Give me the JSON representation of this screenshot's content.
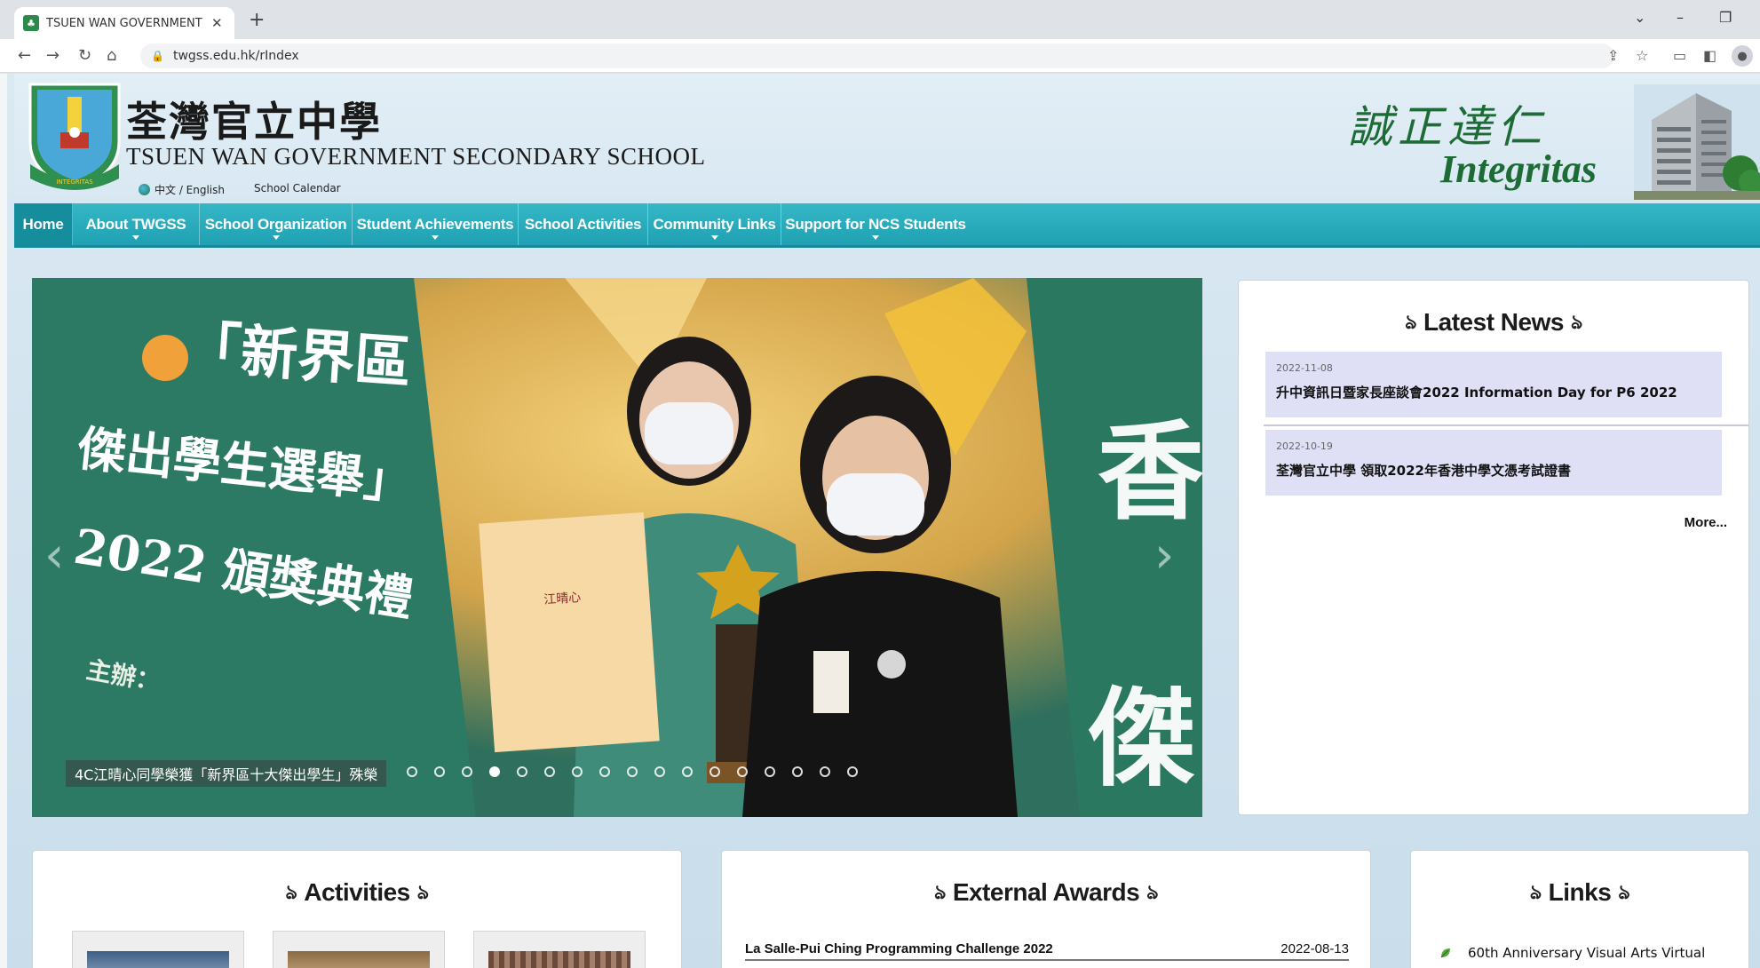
{
  "browser": {
    "tab_title": "TSUEN WAN GOVERNMENT SEC",
    "tab_favicon": "school-favicon",
    "url": "twgss.edu.hk/rIndex"
  },
  "header": {
    "school_name_cn": "荃灣官立中學",
    "school_name_en": "TSUEN WAN GOVERNMENT SECONDARY SCHOOL",
    "lang_link": "中文 / English",
    "calendar_link": "School Calendar",
    "motto_cn": "誠正達仁",
    "motto_en": "Integritas"
  },
  "nav": {
    "items": [
      {
        "label": "Home",
        "has_dropdown": false
      },
      {
        "label": "About TWGSS",
        "has_dropdown": true
      },
      {
        "label": "School Organization",
        "has_dropdown": true
      },
      {
        "label": "Student Achievements",
        "has_dropdown": true
      },
      {
        "label": "School Activities",
        "has_dropdown": false
      },
      {
        "label": "Community Links",
        "has_dropdown": true
      },
      {
        "label": "Support for NCS Students",
        "has_dropdown": true
      }
    ]
  },
  "slider": {
    "caption": "4C江晴心同學榮獲「新界區十大傑出學生」殊榮",
    "banner_text": [
      "「新界區",
      "傑出學生選舉」",
      "2022 頒獎典禮",
      "主辦："
    ],
    "dot_count": 17,
    "active_dot": 3
  },
  "latest_news": {
    "title": "Latest News",
    "items": [
      {
        "date": "2022-11-08",
        "title": "升中資訊日暨家長座談會2022 Information Day for P6 2022"
      },
      {
        "date": "2022-10-19",
        "title": "荃灣官立中學 領取2022年香港中學文憑考試證書"
      }
    ],
    "more": "More..."
  },
  "activities": {
    "title": "Activities"
  },
  "external_awards": {
    "title": "External Awards",
    "items": [
      {
        "name": "La Salle-Pui Ching Programming Challenge 2022",
        "date": "2022-08-13"
      }
    ]
  },
  "links": {
    "title": "Links",
    "items": [
      {
        "label": "60th Anniversary Visual Arts Virtual"
      }
    ]
  },
  "colors": {
    "nav_bg": "#22a6b8",
    "nav_active": "#168d9d",
    "motto_green": "#1d6b35",
    "news_item_bg": "#dfe0f6"
  }
}
